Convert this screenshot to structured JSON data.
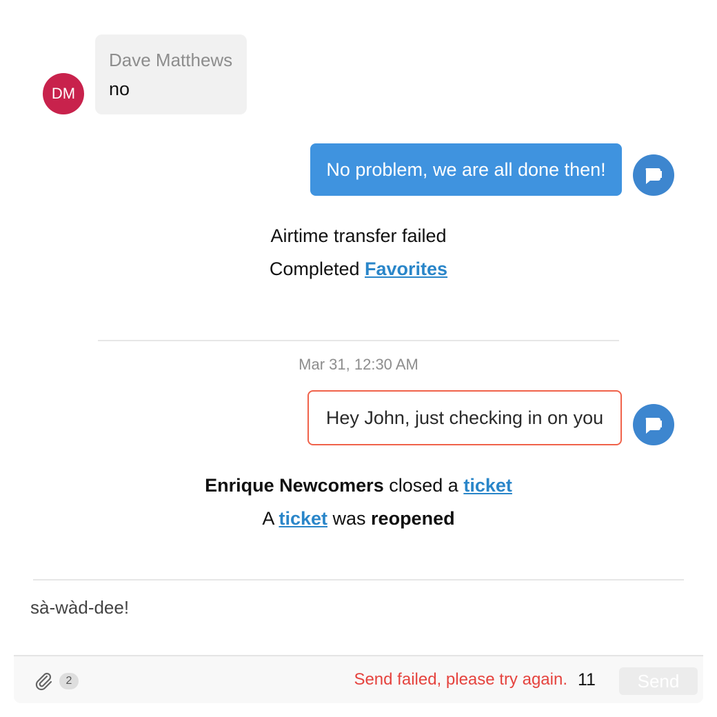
{
  "messages": {
    "incoming": {
      "avatar_initials": "DM",
      "sender": "Dave Matthews",
      "text": "no"
    },
    "outgoing_1": {
      "text": "No problem, we are all done then!"
    },
    "outgoing_failed": {
      "text": "Hey John, just checking in on you"
    }
  },
  "events": {
    "airtime": "Airtime transfer failed",
    "completed_prefix": "Completed",
    "completed_link": "Favorites",
    "closed_actor": "Enrique Newcomers",
    "closed_middle": "closed a",
    "closed_link": "ticket",
    "reopen_prefix": "A",
    "reopen_link": "ticket",
    "reopen_middle": "was",
    "reopen_action": "reopened"
  },
  "timestamp": "Mar 31, 12:30 AM",
  "composer": {
    "text": "sà-wàd-dee!",
    "attachment_count": "2",
    "error": "Send failed, please try again.",
    "char_count": "11",
    "send_label": "Send"
  },
  "colors": {
    "avatar_dm": "#c8224c",
    "agent_avatar": "#3d86cf",
    "outgoing_bubble": "#3f93df",
    "failed_border": "#f0624a",
    "link": "#2a86c9",
    "error": "#e5433e"
  },
  "icons": {
    "agent_avatar": "chat-bubble-icon",
    "attachment": "paperclip-icon"
  }
}
